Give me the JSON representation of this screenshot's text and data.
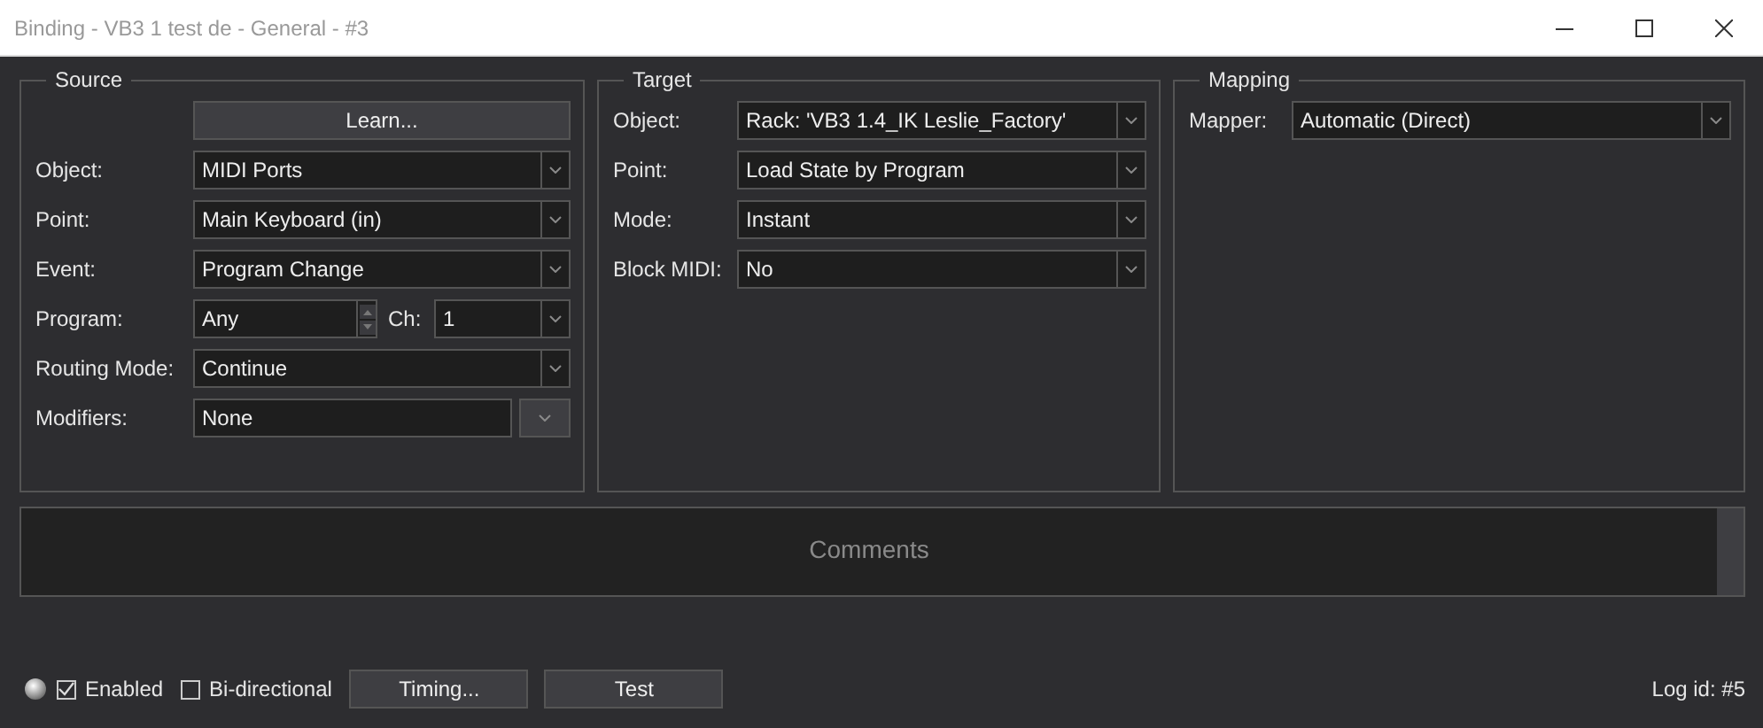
{
  "window": {
    "title": "Binding - VB3 1 test de - General - #3"
  },
  "groups": [
    {
      "title": "Source",
      "learn_button": "Learn...",
      "rows": [
        {
          "kind": "combo",
          "label": "Object:",
          "value": "MIDI Ports"
        },
        {
          "kind": "combo",
          "label": "Point:",
          "value": "Main Keyboard (in)"
        },
        {
          "kind": "combo",
          "label": "Event:",
          "value": "Program Change"
        },
        {
          "kind": "spin_combo",
          "label": "Program:",
          "value": "Any",
          "sub_label": "Ch:",
          "sub_value": "1"
        },
        {
          "kind": "combo",
          "label": "Routing Mode:",
          "value": "Continue"
        },
        {
          "kind": "field_button",
          "label": "Modifiers:",
          "value": "None"
        }
      ]
    },
    {
      "title": "Target",
      "rows": [
        {
          "kind": "combo",
          "label": "Object:",
          "value": "Rack: 'VB3 1.4_IK Leslie_Factory'"
        },
        {
          "kind": "combo",
          "label": "Point:",
          "value": "Load State by Program"
        },
        {
          "kind": "combo",
          "label": "Mode:",
          "value": "Instant"
        },
        {
          "kind": "combo",
          "label": "Block MIDI:",
          "value": "No"
        }
      ]
    },
    {
      "title": "Mapping",
      "rows": [
        {
          "kind": "combo",
          "label": "Mapper:",
          "value": "Automatic (Direct)"
        }
      ]
    }
  ],
  "comments": {
    "placeholder": "Comments"
  },
  "footer": {
    "checkboxes": [
      {
        "label": "Enabled",
        "checked": true
      },
      {
        "label": "Bi-directional",
        "checked": false
      }
    ],
    "buttons": [
      "Timing...",
      "Test"
    ],
    "log_id": "Log id: #5"
  }
}
